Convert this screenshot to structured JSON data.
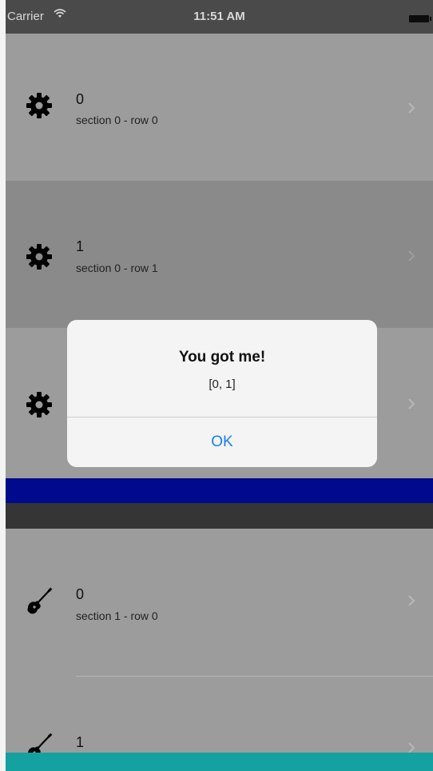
{
  "status_bar": {
    "carrier": "Carrier",
    "time": "11:51 AM"
  },
  "sections": [
    {
      "rows": [
        {
          "title": "0",
          "subtitle": "section 0 - row 0",
          "icon": "gear-icon"
        },
        {
          "title": "1",
          "subtitle": "section 0 - row 1",
          "icon": "gear-icon"
        },
        {
          "title": "",
          "subtitle": "",
          "icon": "gear-icon"
        }
      ]
    },
    {
      "rows": [
        {
          "title": "0",
          "subtitle": "section 1 - row 0",
          "icon": "guitar-icon"
        },
        {
          "title": "1",
          "subtitle": "",
          "icon": "guitar-icon"
        }
      ]
    }
  ],
  "alert": {
    "title": "You got me!",
    "message": "[0, 1]",
    "button": "OK"
  },
  "colors": {
    "alert_button": "#1a7cf4",
    "blue_bar": "#010a8d",
    "teal_bar": "#14a1a0",
    "dark_bar": "#353535"
  }
}
